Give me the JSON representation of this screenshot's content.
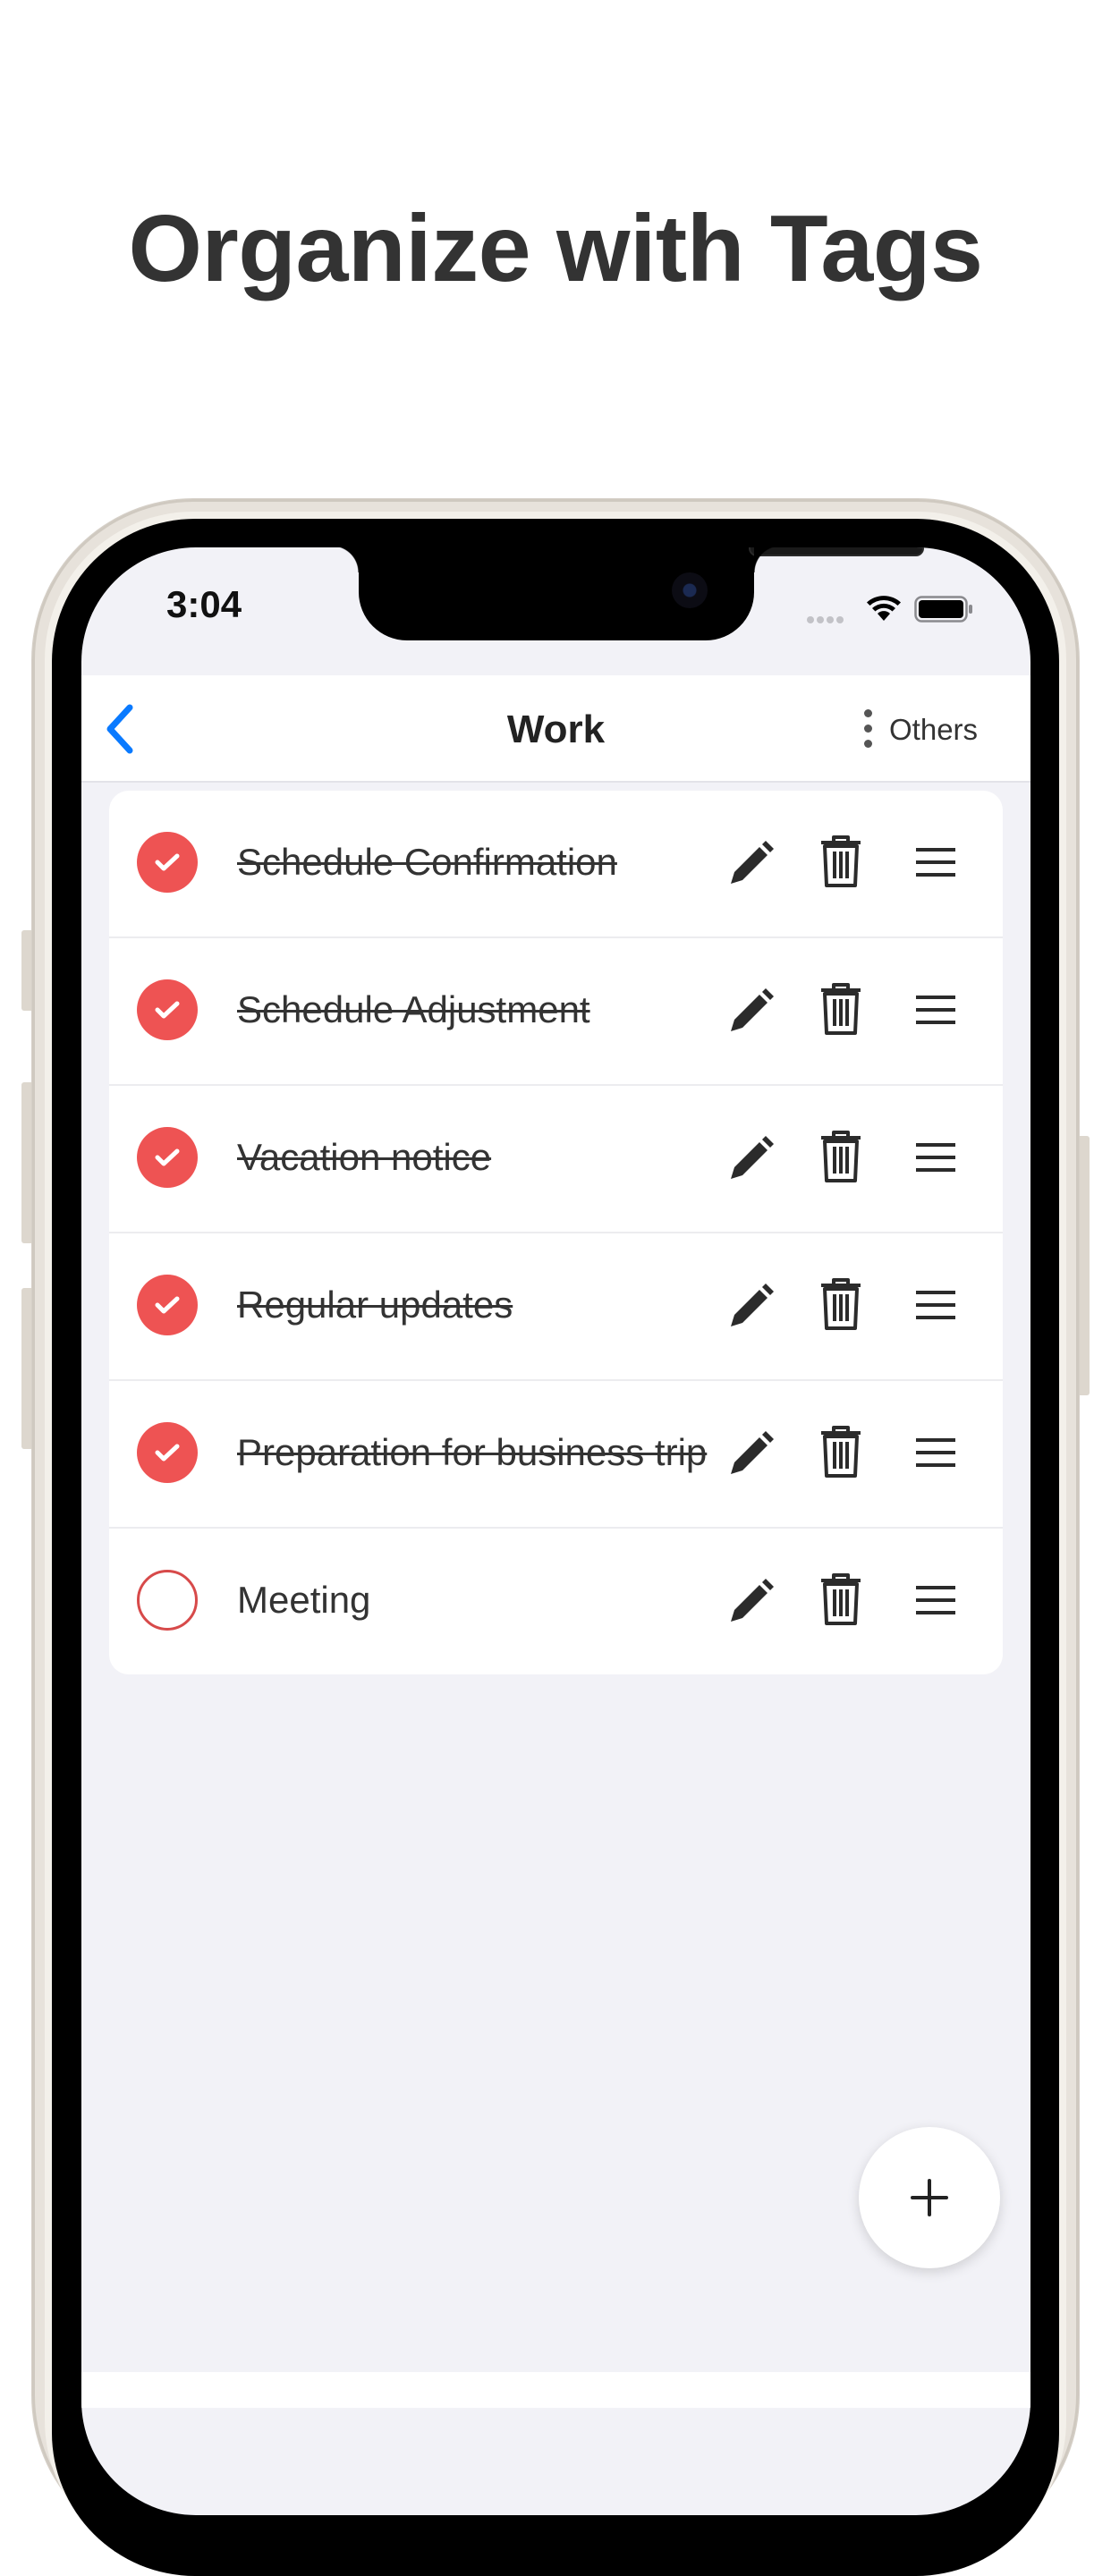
{
  "headline": "Organize with Tags",
  "status_bar": {
    "time": "3:04"
  },
  "nav": {
    "back_icon": "chevron-left-icon",
    "title": "Work",
    "more_icon": "vertical-dots-icon",
    "others_label": "Others"
  },
  "tasks": [
    {
      "label": "Schedule Confirmation",
      "completed": true
    },
    {
      "label": "Schedule Adjustment",
      "completed": true
    },
    {
      "label": "Vacation notice",
      "completed": true
    },
    {
      "label": "Regular updates",
      "completed": true
    },
    {
      "label": "Preparation for business trip",
      "completed": true
    },
    {
      "label": "Meeting",
      "completed": false
    }
  ],
  "row_icons": [
    "pencil-icon",
    "trash-icon",
    "drag-handle-icon"
  ],
  "fab_icon": "plus-icon",
  "colors": {
    "accent_blue": "#0a7aff",
    "check_red": "#ee5353",
    "screen_bg": "#f2f2f7",
    "headline": "#333333"
  }
}
